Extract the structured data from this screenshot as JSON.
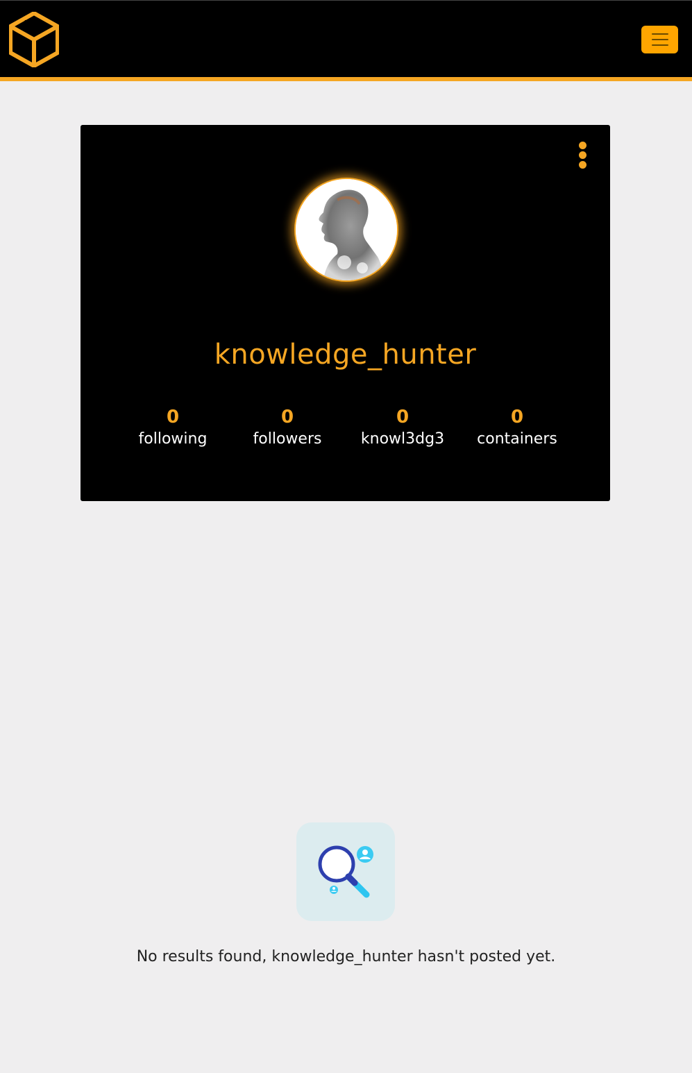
{
  "header": {
    "logo_icon": "cube-logo-icon",
    "menu_icon": "hamburger-menu-icon",
    "accent_color": "#f5a623",
    "background_color": "#000000"
  },
  "profile": {
    "options_icon": "kebab-menu-icon",
    "avatar_icon": "profile-avatar",
    "username": "knowledge_hunter",
    "stats": [
      {
        "count": "0",
        "label": "following"
      },
      {
        "count": "0",
        "label": "followers"
      },
      {
        "count": "0",
        "label": "knowl3dg3"
      },
      {
        "count": "0",
        "label": "containers"
      }
    ]
  },
  "empty_state": {
    "icon": "search-people-icon",
    "message": "No results found, knowledge_hunter hasn't posted yet."
  }
}
